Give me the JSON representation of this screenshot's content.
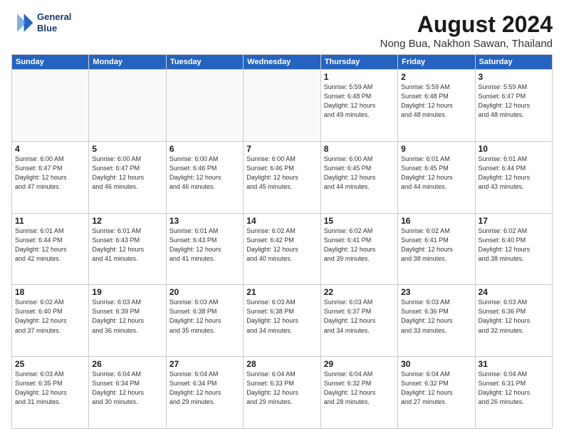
{
  "header": {
    "logo_line1": "General",
    "logo_line2": "Blue",
    "main_title": "August 2024",
    "sub_title": "Nong Bua, Nakhon Sawan, Thailand"
  },
  "days_of_week": [
    "Sunday",
    "Monday",
    "Tuesday",
    "Wednesday",
    "Thursday",
    "Friday",
    "Saturday"
  ],
  "weeks": [
    [
      {
        "day": "",
        "info": ""
      },
      {
        "day": "",
        "info": ""
      },
      {
        "day": "",
        "info": ""
      },
      {
        "day": "",
        "info": ""
      },
      {
        "day": "1",
        "info": "Sunrise: 5:59 AM\nSunset: 6:48 PM\nDaylight: 12 hours\nand 49 minutes."
      },
      {
        "day": "2",
        "info": "Sunrise: 5:59 AM\nSunset: 6:48 PM\nDaylight: 12 hours\nand 48 minutes."
      },
      {
        "day": "3",
        "info": "Sunrise: 5:59 AM\nSunset: 6:47 PM\nDaylight: 12 hours\nand 48 minutes."
      }
    ],
    [
      {
        "day": "4",
        "info": "Sunrise: 6:00 AM\nSunset: 6:47 PM\nDaylight: 12 hours\nand 47 minutes."
      },
      {
        "day": "5",
        "info": "Sunrise: 6:00 AM\nSunset: 6:47 PM\nDaylight: 12 hours\nand 46 minutes."
      },
      {
        "day": "6",
        "info": "Sunrise: 6:00 AM\nSunset: 6:46 PM\nDaylight: 12 hours\nand 46 minutes."
      },
      {
        "day": "7",
        "info": "Sunrise: 6:00 AM\nSunset: 6:46 PM\nDaylight: 12 hours\nand 45 minutes."
      },
      {
        "day": "8",
        "info": "Sunrise: 6:00 AM\nSunset: 6:45 PM\nDaylight: 12 hours\nand 44 minutes."
      },
      {
        "day": "9",
        "info": "Sunrise: 6:01 AM\nSunset: 6:45 PM\nDaylight: 12 hours\nand 44 minutes."
      },
      {
        "day": "10",
        "info": "Sunrise: 6:01 AM\nSunset: 6:44 PM\nDaylight: 12 hours\nand 43 minutes."
      }
    ],
    [
      {
        "day": "11",
        "info": "Sunrise: 6:01 AM\nSunset: 6:44 PM\nDaylight: 12 hours\nand 42 minutes."
      },
      {
        "day": "12",
        "info": "Sunrise: 6:01 AM\nSunset: 6:43 PM\nDaylight: 12 hours\nand 41 minutes."
      },
      {
        "day": "13",
        "info": "Sunrise: 6:01 AM\nSunset: 6:43 PM\nDaylight: 12 hours\nand 41 minutes."
      },
      {
        "day": "14",
        "info": "Sunrise: 6:02 AM\nSunset: 6:42 PM\nDaylight: 12 hours\nand 40 minutes."
      },
      {
        "day": "15",
        "info": "Sunrise: 6:02 AM\nSunset: 6:41 PM\nDaylight: 12 hours\nand 39 minutes."
      },
      {
        "day": "16",
        "info": "Sunrise: 6:02 AM\nSunset: 6:41 PM\nDaylight: 12 hours\nand 38 minutes."
      },
      {
        "day": "17",
        "info": "Sunrise: 6:02 AM\nSunset: 6:40 PM\nDaylight: 12 hours\nand 38 minutes."
      }
    ],
    [
      {
        "day": "18",
        "info": "Sunrise: 6:02 AM\nSunset: 6:40 PM\nDaylight: 12 hours\nand 37 minutes."
      },
      {
        "day": "19",
        "info": "Sunrise: 6:03 AM\nSunset: 6:39 PM\nDaylight: 12 hours\nand 36 minutes."
      },
      {
        "day": "20",
        "info": "Sunrise: 6:03 AM\nSunset: 6:38 PM\nDaylight: 12 hours\nand 35 minutes."
      },
      {
        "day": "21",
        "info": "Sunrise: 6:03 AM\nSunset: 6:38 PM\nDaylight: 12 hours\nand 34 minutes."
      },
      {
        "day": "22",
        "info": "Sunrise: 6:03 AM\nSunset: 6:37 PM\nDaylight: 12 hours\nand 34 minutes."
      },
      {
        "day": "23",
        "info": "Sunrise: 6:03 AM\nSunset: 6:36 PM\nDaylight: 12 hours\nand 33 minutes."
      },
      {
        "day": "24",
        "info": "Sunrise: 6:03 AM\nSunset: 6:36 PM\nDaylight: 12 hours\nand 32 minutes."
      }
    ],
    [
      {
        "day": "25",
        "info": "Sunrise: 6:03 AM\nSunset: 6:35 PM\nDaylight: 12 hours\nand 31 minutes."
      },
      {
        "day": "26",
        "info": "Sunrise: 6:04 AM\nSunset: 6:34 PM\nDaylight: 12 hours\nand 30 minutes."
      },
      {
        "day": "27",
        "info": "Sunrise: 6:04 AM\nSunset: 6:34 PM\nDaylight: 12 hours\nand 29 minutes."
      },
      {
        "day": "28",
        "info": "Sunrise: 6:04 AM\nSunset: 6:33 PM\nDaylight: 12 hours\nand 29 minutes."
      },
      {
        "day": "29",
        "info": "Sunrise: 6:04 AM\nSunset: 6:32 PM\nDaylight: 12 hours\nand 28 minutes."
      },
      {
        "day": "30",
        "info": "Sunrise: 6:04 AM\nSunset: 6:32 PM\nDaylight: 12 hours\nand 27 minutes."
      },
      {
        "day": "31",
        "info": "Sunrise: 6:04 AM\nSunset: 6:31 PM\nDaylight: 12 hours\nand 26 minutes."
      }
    ]
  ]
}
